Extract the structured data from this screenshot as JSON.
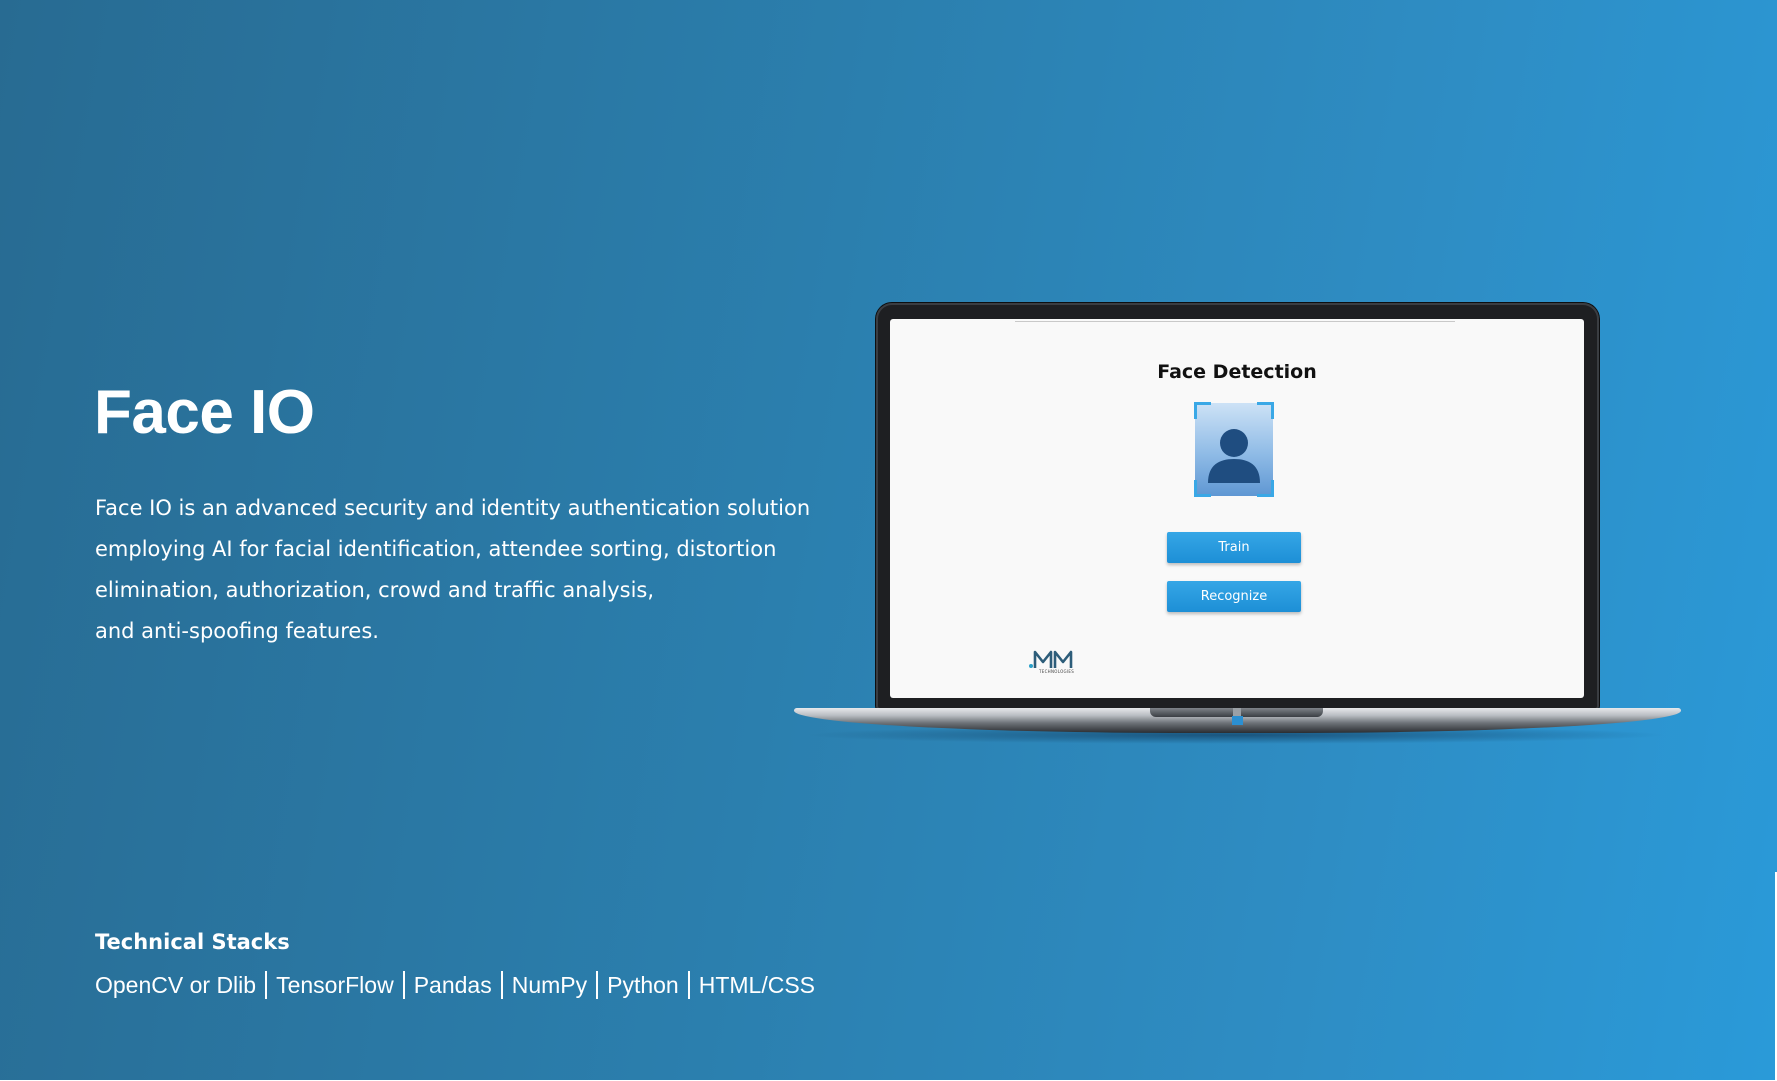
{
  "hero": {
    "title": "Face IO",
    "description_lines": [
      "Face IO is an advanced security and identity authentication solution",
      "employing AI for facial identification, attendee sorting, distortion",
      "elimination, authorization, crowd and traffic analysis,",
      "and anti-spoofing features."
    ]
  },
  "stacks": {
    "heading": "Technical Stacks",
    "items": [
      "OpenCV or Dlib",
      "TensorFlow",
      "Pandas",
      "NumPy",
      "Python",
      "HTML/CSS"
    ]
  },
  "laptop_screen": {
    "title": "Face Detection",
    "face_icon": "user-silhouette-icon",
    "train_label": "Train",
    "recognize_label": "Recognize",
    "logo_mark": ".MM",
    "logo_subtext": "TECHNOLOGIES"
  },
  "colors": {
    "background_start": "#286b92",
    "background_end": "#2a9ad9",
    "button_blue": "#1d8fd6",
    "frame_corner": "#3aa8e6",
    "text_white": "#ffffff"
  }
}
